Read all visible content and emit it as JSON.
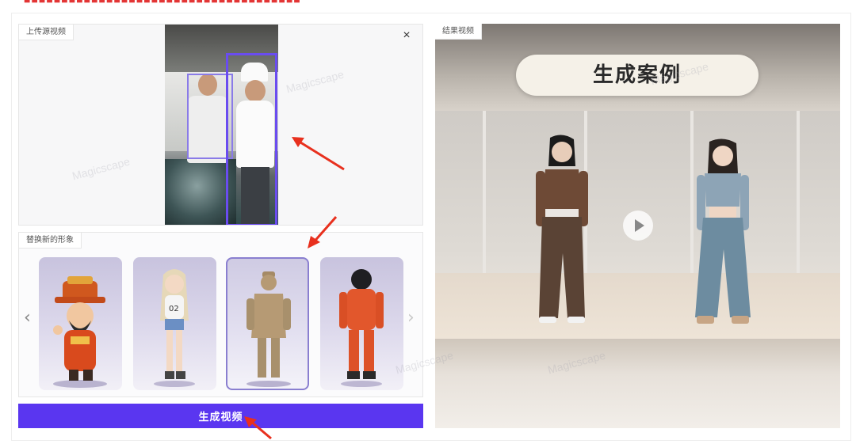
{
  "upload_panel": {
    "tag": "上传源视频",
    "close_symbol": "×"
  },
  "swap_panel": {
    "tag": "替换新的形象",
    "prev_symbol": "‹",
    "next_symbol": "›",
    "selected_index": 2
  },
  "generate_button": {
    "label": "生成视频"
  },
  "result_panel": {
    "tag": "结果视频",
    "banner_text": "生成案例"
  },
  "watermark_text": "Magicscape",
  "colors": {
    "accent": "#5a36f0",
    "bbox": "#6a4cf0",
    "arrow": "#e8301e"
  },
  "icons": [
    "close-icon",
    "chevron-left-icon",
    "chevron-right-icon",
    "play-icon"
  ]
}
